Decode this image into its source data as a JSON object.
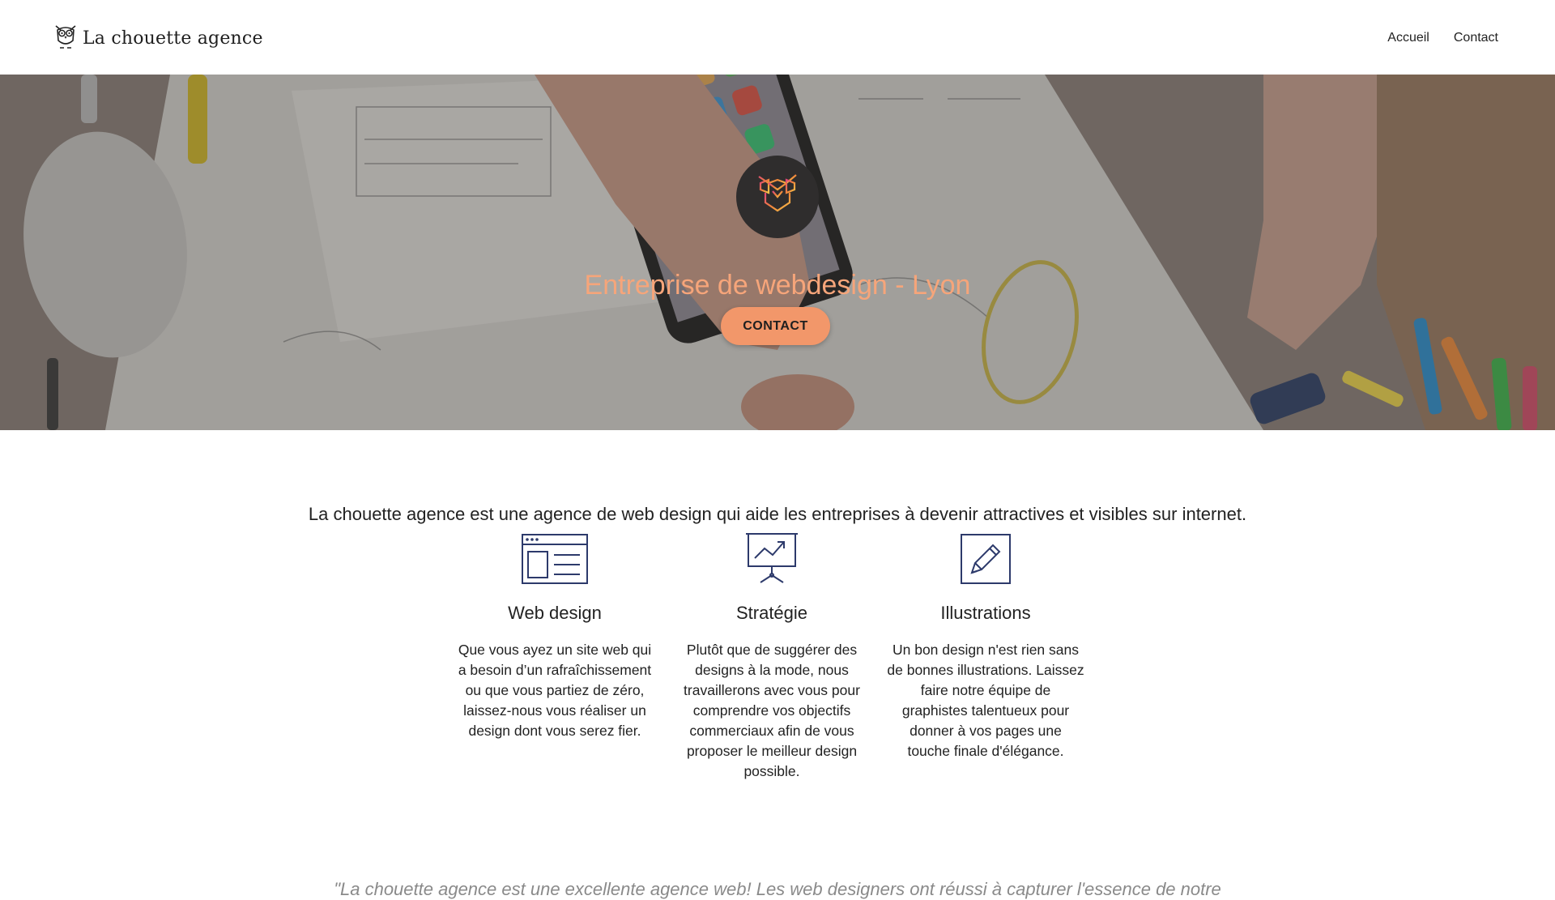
{
  "header": {
    "brand": "La chouette agence",
    "nav": [
      "Accueil",
      "Contact"
    ]
  },
  "hero": {
    "title": "Entreprise de webdesign - Lyon",
    "cta": "CONTACT"
  },
  "intro": "La chouette agence est une agence de web design qui aide les entreprises à devenir attractives et visibles sur internet.",
  "services": [
    {
      "icon": "web-layout-icon",
      "title": "Web design",
      "text": "Que vous ayez un site web qui a besoin d’un rafraîchissement ou que vous partiez de zéro, laissez-nous vous réaliser un design dont vous serez fier."
    },
    {
      "icon": "presentation-chart-icon",
      "title": "Stratégie",
      "text": "Plutôt que de suggérer des designs à la mode, nous travaillerons avec vous pour comprendre vos objectifs commerciaux afin de vous proposer le meilleur design possible."
    },
    {
      "icon": "pencil-icon",
      "title": "Illustrations",
      "text": "Un bon design n'est rien sans de bonnes illustrations. Laissez faire notre équipe de graphistes talentueux pour donner à vos pages une touche finale d'élégance."
    }
  ],
  "testimonial": "\"La chouette agence est une excellente agence web! Les web designers ont réussi à capturer l'essence de notre",
  "colors": {
    "accent": "#f2976a",
    "hero_title": "#f6a57a",
    "icon_stroke": "#2d3a6b",
    "hero_logo_bg": "#2f2d2d"
  }
}
